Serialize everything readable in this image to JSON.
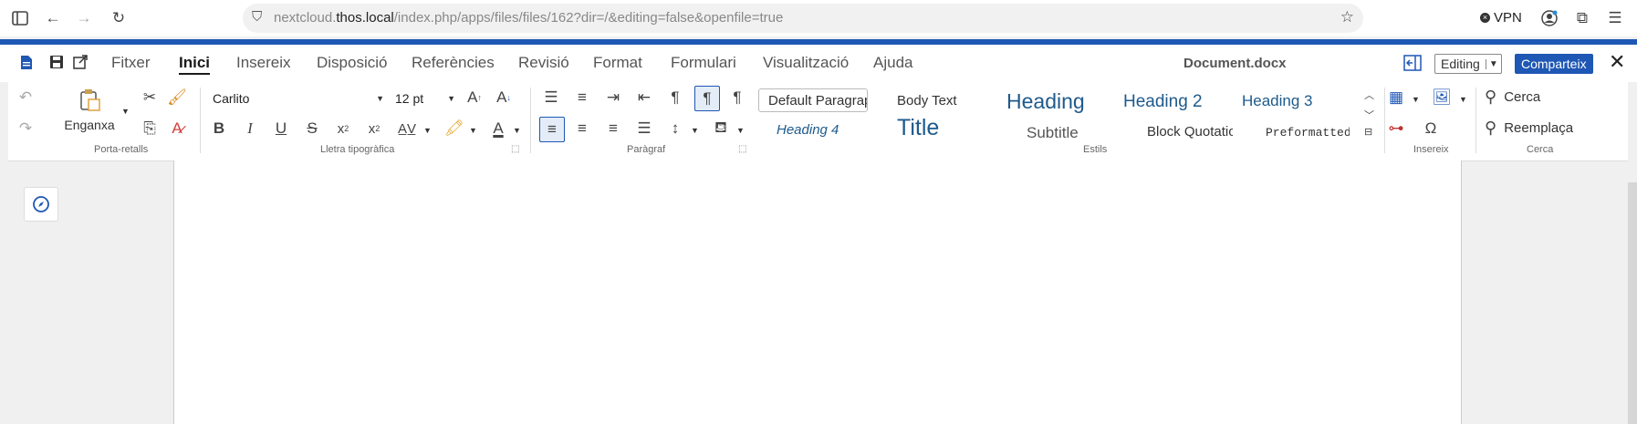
{
  "browser": {
    "url_prefix": "nextcloud.",
    "url_domain": "thos.local",
    "url_path": "/index.php/apps/files/files/162?dir=/&editing=false&openfile=true",
    "vpn_label": "VPN"
  },
  "menu": {
    "tabs": [
      "Fitxer",
      "Inici",
      "Insereix",
      "Disposició",
      "Referències",
      "Revisió",
      "Format",
      "Formulari",
      "Visualització",
      "Ajuda"
    ],
    "active_tab": "Inici",
    "document_title": "Document.docx",
    "mode": "Editing",
    "share_label": "Comparteix"
  },
  "ribbon": {
    "clipboard": {
      "paste_label": "Enganxa",
      "group_label": "Porta-retalls"
    },
    "font": {
      "name": "Carlito",
      "size": "12 pt",
      "group_label": "Lletra tipogràfica"
    },
    "paragraph": {
      "group_label": "Paràgraf"
    },
    "styles": {
      "items": [
        "Default Paragraph",
        "Body Text",
        "Heading",
        "Heading 2",
        "Heading 3",
        "Heading 4",
        "Title",
        "Subtitle",
        "Block Quotation",
        "Preformatted"
      ],
      "group_label": "Estils"
    },
    "insert": {
      "group_label": "Insereix"
    },
    "search": {
      "find_label": "Cerca",
      "replace_label": "Reemplaça",
      "group_label": "Cerca"
    }
  },
  "colors": {
    "accent": "#1f57b5",
    "heading": "#1e5a8c"
  }
}
